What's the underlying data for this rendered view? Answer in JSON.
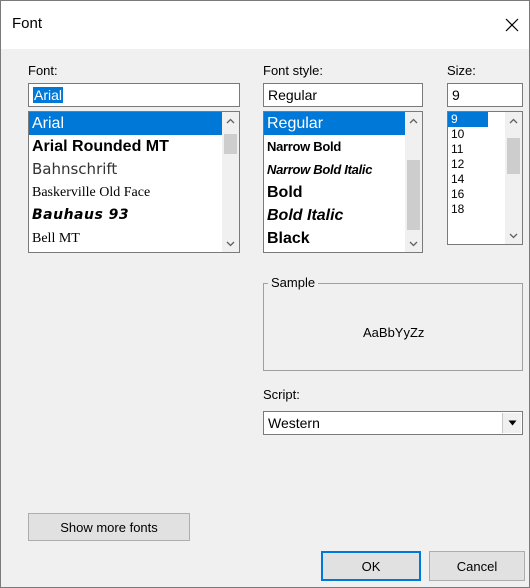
{
  "window": {
    "title": "Font"
  },
  "font": {
    "label": "Font:",
    "value": "Arial",
    "items": [
      {
        "label": "Arial",
        "selected": true
      },
      {
        "label": "Arial Rounded MT",
        "selected": false
      },
      {
        "label": "Bahnschrift",
        "selected": false
      },
      {
        "label": "Baskerville Old Face",
        "selected": false
      },
      {
        "label": "Bauhaus 93",
        "selected": false
      },
      {
        "label": "Bell MT",
        "selected": false
      }
    ]
  },
  "style": {
    "label": "Font style:",
    "value": "Regular",
    "items": [
      {
        "label": "Regular",
        "selected": true
      },
      {
        "label": "Narrow Bold",
        "selected": false
      },
      {
        "label": "Narrow Bold Italic",
        "selected": false
      },
      {
        "label": "Bold",
        "selected": false
      },
      {
        "label": "Bold Italic",
        "selected": false
      },
      {
        "label": "Black",
        "selected": false
      }
    ]
  },
  "size": {
    "label": "Size:",
    "value": "9",
    "items": [
      {
        "label": "9",
        "selected": true
      },
      {
        "label": "10",
        "selected": false
      },
      {
        "label": "11",
        "selected": false
      },
      {
        "label": "12",
        "selected": false
      },
      {
        "label": "14",
        "selected": false
      },
      {
        "label": "16",
        "selected": false
      },
      {
        "label": "18",
        "selected": false
      }
    ]
  },
  "sample": {
    "label": "Sample",
    "text": "AaBbYyZz"
  },
  "script": {
    "label": "Script:",
    "value": "Western"
  },
  "buttons": {
    "show_more": "Show more fonts",
    "ok": "OK",
    "cancel": "Cancel"
  },
  "colors": {
    "selection": "#0078d7",
    "dialog_bg": "#f0f0f0",
    "button_bg": "#e1e1e1"
  }
}
